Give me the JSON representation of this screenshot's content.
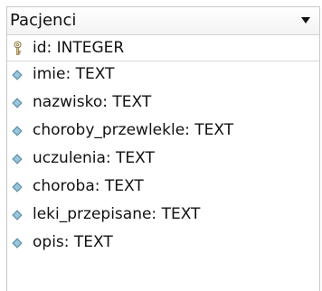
{
  "table": {
    "name": "Pacjenci",
    "fields": [
      {
        "label": "id: INTEGER",
        "icon": "key-icon",
        "primary_key": true
      },
      {
        "label": "imie: TEXT",
        "icon": "field-diamond-icon"
      },
      {
        "label": "nazwisko: TEXT",
        "icon": "field-diamond-icon"
      },
      {
        "label": "choroby_przewlekle: TEXT",
        "icon": "field-diamond-icon"
      },
      {
        "label": "uczulenia: TEXT",
        "icon": "field-diamond-icon"
      },
      {
        "label": "choroba: TEXT",
        "icon": "field-diamond-icon"
      },
      {
        "label": "leki_przepisane: TEXT",
        "icon": "field-diamond-icon"
      },
      {
        "label": "opis: TEXT",
        "icon": "field-diamond-icon"
      }
    ]
  },
  "colors": {
    "border": "#c9c9c9",
    "diamond": "#7fb0c6",
    "key": "#d8c28a"
  },
  "icons": {
    "dropdown": "chevron-down-icon"
  }
}
